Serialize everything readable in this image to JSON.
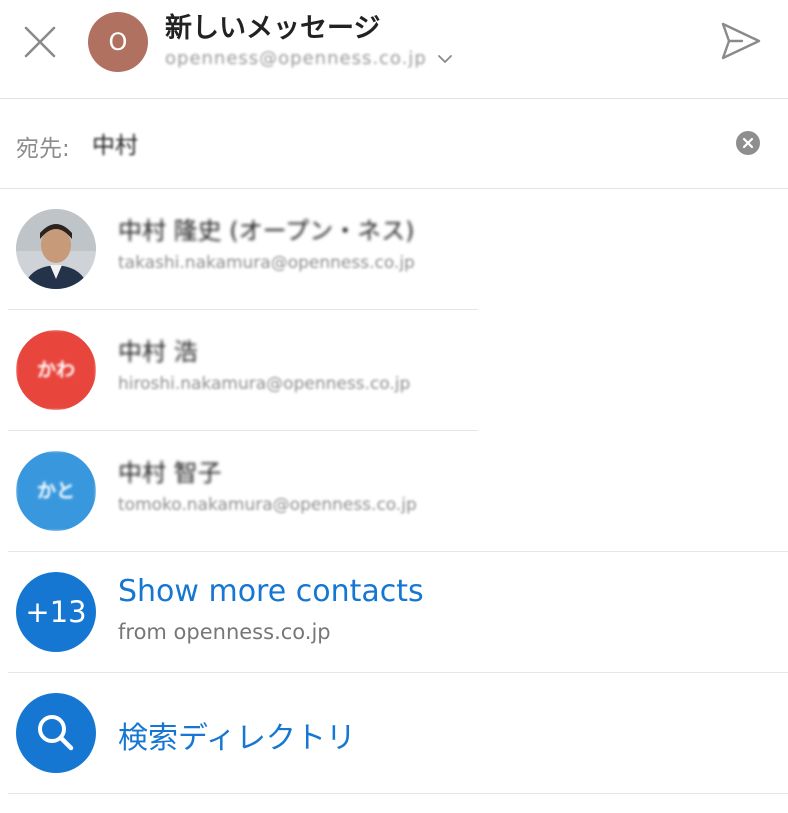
{
  "header": {
    "avatar_letter": "O",
    "avatar_color": "#b07160",
    "title": "新しいメッセージ",
    "from_email": "openness@openness.co.jp"
  },
  "compose": {
    "to_label": "宛先:",
    "to_value": "中村"
  },
  "contacts": [
    {
      "name": "中村 隆史 (オープン・ネス)",
      "email": "takashi.nakamura@openness.co.jp",
      "avatar": "photo"
    },
    {
      "name": "中村 浩",
      "email": "hiroshi.nakamura@openness.co.jp",
      "initials": "かわ",
      "avatar_color": "#e8453c"
    },
    {
      "name": "中村 智子",
      "email": "tomoko.nakamura@openness.co.jp",
      "initials": "かと",
      "avatar_color": "#3998dd"
    }
  ],
  "more_contacts": {
    "count_badge": "+13",
    "label": "Show more contacts",
    "sublabel": "from openness.co.jp"
  },
  "search_directory": {
    "label": "検索ディレクトリ"
  },
  "colors": {
    "accent": "#1677d2",
    "divider": "#e2e2e2"
  }
}
